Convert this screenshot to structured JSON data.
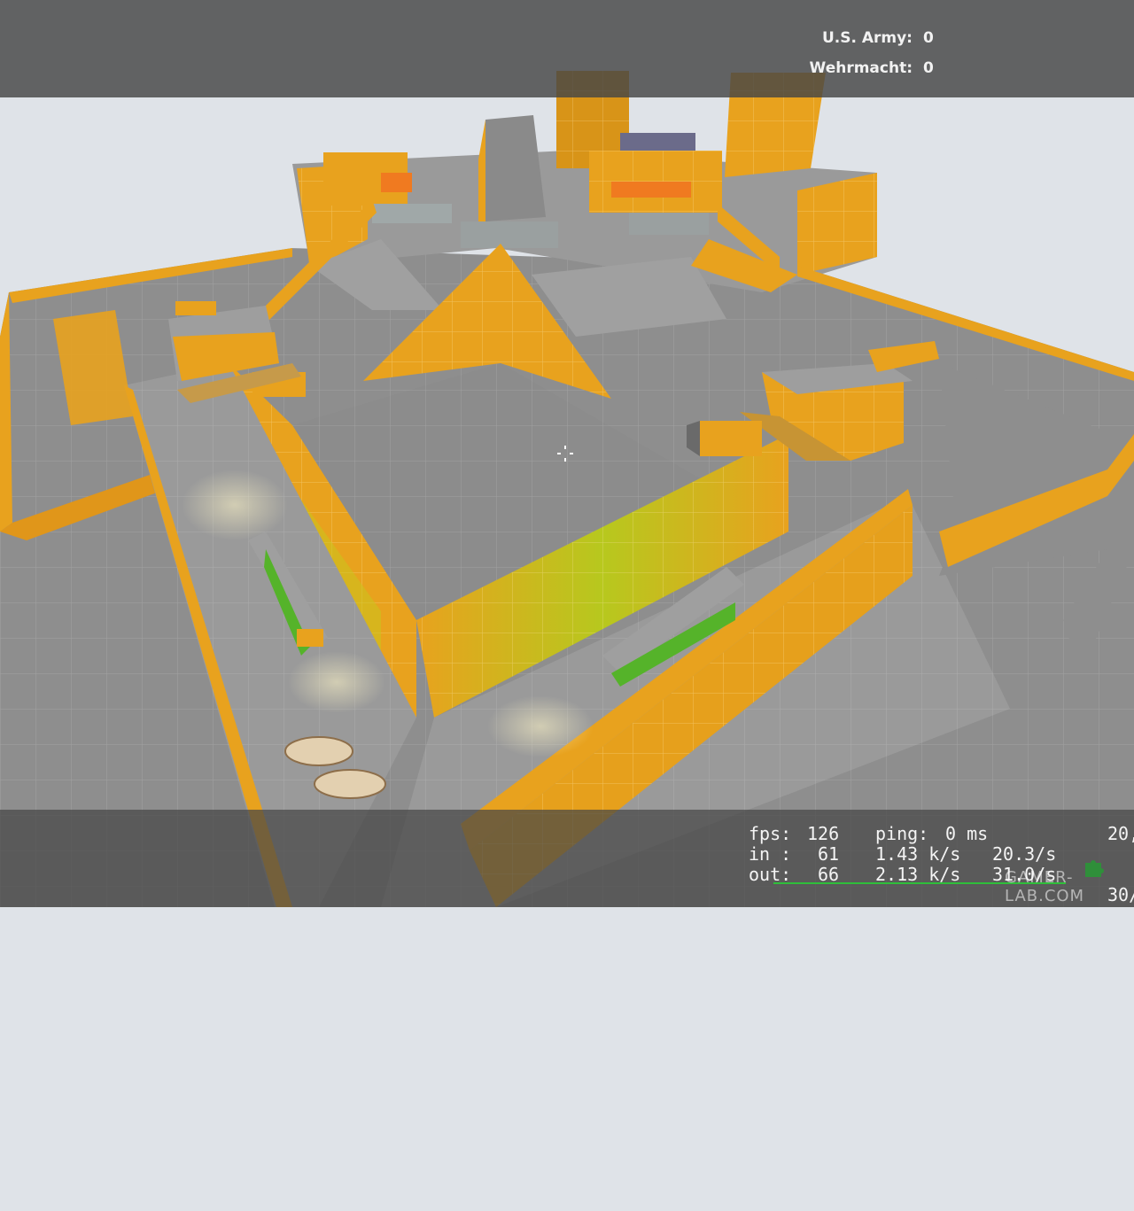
{
  "scoreboard": {
    "teams": [
      {
        "name": "U.S. Army:",
        "score": "0"
      },
      {
        "name": "Wehrmacht:",
        "score": "0"
      }
    ]
  },
  "netgraph": {
    "fps_label": "fps:",
    "fps": "126",
    "ping_label": "ping:",
    "ping": "0 ms",
    "in_label": "in :",
    "in_count": "61",
    "in_rate": "1.43 k/s",
    "in_pps": "20.3/s",
    "out_label": "out:",
    "out_count": "66",
    "out_rate": "2.13 k/s",
    "out_pps": "31.0/s",
    "corner_top": "20,",
    "corner_bottom": "30/"
  },
  "watermark": "GAMER-LAB.COM",
  "colors": {
    "wall_orange": "#e8a21e",
    "floor_gray": "#8f8f8f",
    "sky": "#dfe3e8",
    "hud_bar": "#464646"
  },
  "icons": {
    "crosshair": "crosshair-icon",
    "watermark_logo": "puzzle-piece-icon"
  }
}
